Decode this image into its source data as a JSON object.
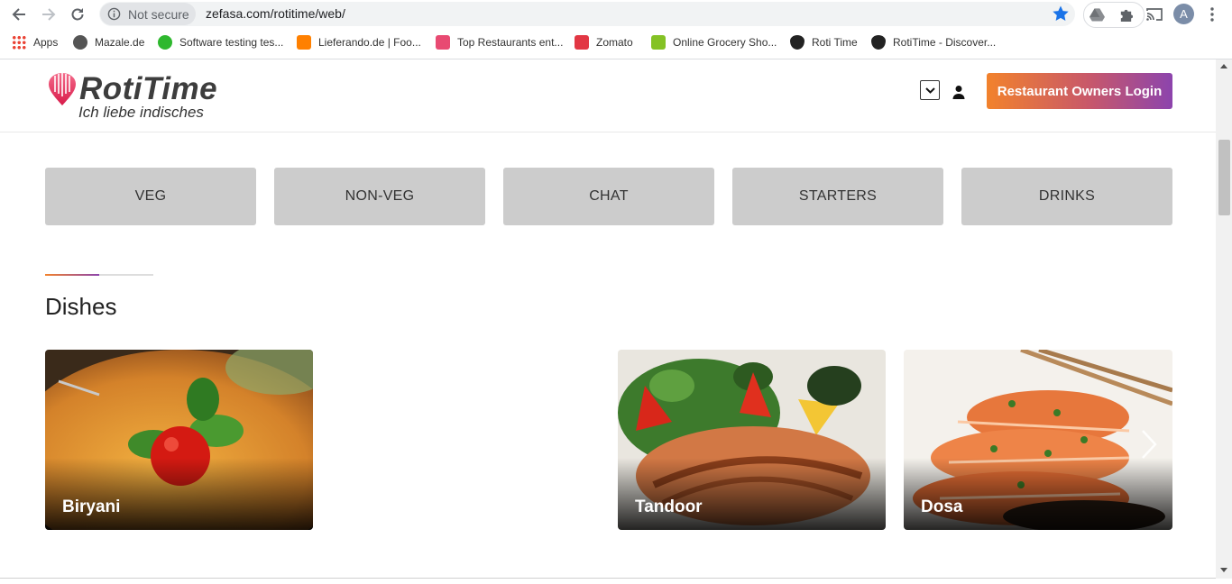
{
  "browser": {
    "security_label": "Not secure",
    "url": "zefasa.com/rotitime/web/",
    "profile_initial": "A",
    "bookmarks": [
      {
        "label": "Apps",
        "icon": "apps-grid-icon",
        "color": "#4285f4"
      },
      {
        "label": "Mazale.de",
        "icon": "mazale-icon",
        "color": "#555555"
      },
      {
        "label": "Software testing tes...",
        "icon": "qa-icon",
        "color": "#2eb82e"
      },
      {
        "label": "Lieferando.de | Foo...",
        "icon": "lieferando-icon",
        "color": "#ff8000"
      },
      {
        "label": "Top Restaurants ent...",
        "icon": "percent-icon",
        "color": "#e84a72"
      },
      {
        "label": "Zomato",
        "icon": "zomato-icon",
        "color": "#e23744"
      },
      {
        "label": "Online Grocery Sho...",
        "icon": "bigbasket-icon",
        "color": "#84c225"
      },
      {
        "label": "Roti Time",
        "icon": "rotitime-icon",
        "color": "#222222"
      },
      {
        "label": "RotiTime - Discover...",
        "icon": "rotitime-icon",
        "color": "#222222"
      }
    ]
  },
  "header": {
    "logo_title": "RotiTime",
    "logo_tagline": "Ich liebe indisches",
    "owners_login": "Restaurant Owners Login"
  },
  "categories": [
    "VEG",
    "NON-VEG",
    "CHAT",
    "STARTERS",
    "DRINKS"
  ],
  "dishes_section": {
    "title": "Dishes",
    "items": [
      "Biryani",
      "Tandoor",
      "Dosa"
    ]
  },
  "colors": {
    "accent_orange": "#f2822c",
    "accent_purple": "#8c44ad",
    "category_bg": "#cccccc"
  }
}
